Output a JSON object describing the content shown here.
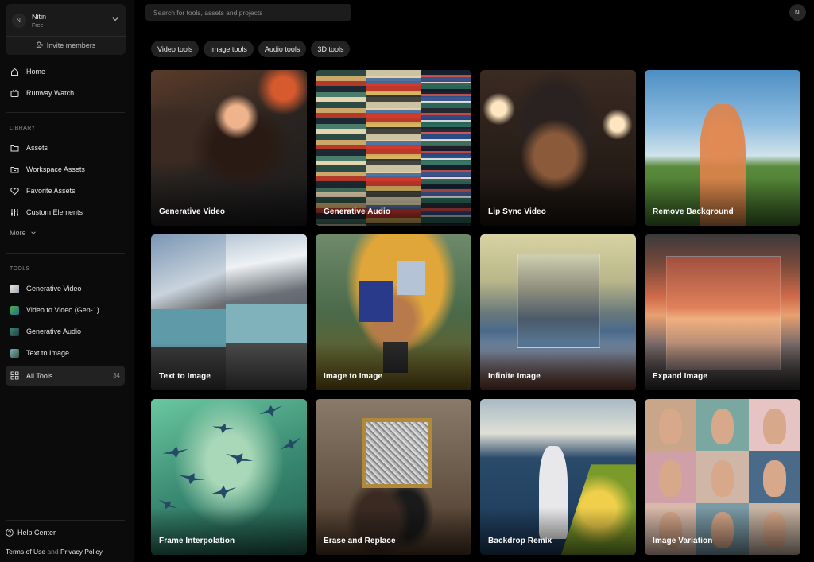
{
  "workspace": {
    "avatar": "Ni",
    "name": "Nitin",
    "plan": "Free",
    "invite_label": "Invite members"
  },
  "nav": {
    "primary": [
      {
        "label": "Home",
        "icon": "home-icon"
      },
      {
        "label": "Runway Watch",
        "icon": "tv-icon"
      }
    ],
    "library_label": "LIBRARY",
    "library": [
      {
        "label": "Assets",
        "icon": "folder-icon"
      },
      {
        "label": "Workspace Assets",
        "icon": "workspace-folder-icon"
      },
      {
        "label": "Favorite Assets",
        "icon": "heart-icon"
      },
      {
        "label": "Custom Elements",
        "icon": "sliders-icon"
      }
    ],
    "more_label": "More",
    "tools_label": "TOOLS",
    "tools": [
      {
        "label": "Generative Video",
        "icon": "generative-video-thumb"
      },
      {
        "label": "Video to Video (Gen-1)",
        "icon": "video-to-video-thumb"
      },
      {
        "label": "Generative Audio",
        "icon": "generative-audio-thumb"
      },
      {
        "label": "Text to Image",
        "icon": "text-to-image-thumb"
      },
      {
        "label": "All Tools",
        "icon": "grid-icon",
        "count": "34",
        "active": true
      }
    ],
    "help_label": "Help Center",
    "footer": {
      "terms": "Terms of Use",
      "and": "and",
      "privacy": "Privacy Policy"
    }
  },
  "search": {
    "placeholder": "Search for tools, assets and projects"
  },
  "user": {
    "avatar": "Ni"
  },
  "filters": [
    "Video tools",
    "Image tools",
    "Audio tools",
    "3D tools"
  ],
  "cards": [
    {
      "label": "Generative Video",
      "art": "a-genvideo"
    },
    {
      "label": "Generative Audio",
      "art": "a-genaudio"
    },
    {
      "label": "Lip Sync Video",
      "art": "a-lipsync"
    },
    {
      "label": "Remove Background",
      "art": "a-removebg"
    },
    {
      "label": "Text to Image",
      "art": "a-text2img"
    },
    {
      "label": "Image to Image",
      "art": "a-img2img"
    },
    {
      "label": "Infinite Image",
      "art": "a-infinite"
    },
    {
      "label": "Expand Image",
      "art": "a-expand"
    },
    {
      "label": "Frame Interpolation",
      "art": "a-frame"
    },
    {
      "label": "Erase and Replace",
      "art": "a-erase"
    },
    {
      "label": "Backdrop Remix",
      "art": "a-backdrop"
    },
    {
      "label": "Image Variation",
      "art": "a-variation"
    }
  ],
  "colors": {
    "background": "#000000",
    "sidebar": "#0b0b0b",
    "chip": "#222222",
    "active_nav": "#222222",
    "muted_text": "#8a8a8a"
  }
}
